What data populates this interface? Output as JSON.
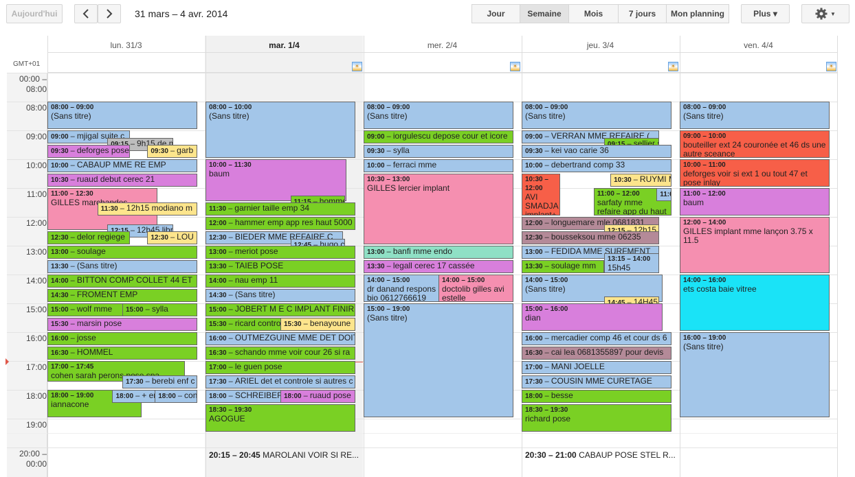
{
  "toolbar": {
    "today_label": "Aujourd'hui",
    "prev_icon": "chevron-left-icon",
    "next_icon": "chevron-right-icon",
    "date_range": "31 mars – 4 avr. 2014",
    "views": [
      "Jour",
      "Semaine",
      "Mois",
      "7 jours",
      "Mon planning"
    ],
    "active_view": "Semaine",
    "more_label": "Plus ▾",
    "settings_icon": "gear-icon"
  },
  "timezone": "GMT+01",
  "days": [
    {
      "label": "lun. 31/3",
      "today": false
    },
    {
      "label": "mar. 1/4",
      "today": true
    },
    {
      "label": "mer. 2/4",
      "today": false
    },
    {
      "label": "jeu. 3/4",
      "today": false
    },
    {
      "label": "ven. 4/4",
      "today": false
    }
  ],
  "hours": [
    "00:00 – 08:00",
    "08:00",
    "09:00",
    "10:00",
    "11:00",
    "12:00",
    "13:00",
    "14:00",
    "15:00",
    "16:00",
    "17:00",
    "18:00",
    "19:00",
    "20:00 – 00:00"
  ],
  "colors": {
    "blue": "#a3c6e9",
    "green": "#7ad024",
    "pink": "#f58fb0",
    "purple": "#d87fdc",
    "red": "#f75f48",
    "yellow": "#fde58c",
    "mauve": "#b48a98",
    "teal": "#8fe0c5",
    "cyan": "#1ae3f7",
    "gray": "#bdbdbd",
    "today_bg": "#f1f1f1"
  },
  "events": [
    {
      "day": 0,
      "start": 8,
      "end": 9,
      "time": "08:00 – 09:00",
      "title": "(Sans titre)",
      "color": "blue",
      "col": 0,
      "cols": 1,
      "tall": true
    },
    {
      "day": 0,
      "start": 9,
      "end": 9.5,
      "time": "09:00",
      "title": "mjigal suite c",
      "color": "blue",
      "col": 0,
      "cols": 2
    },
    {
      "day": 0,
      "start": 9.25,
      "end": 9.75,
      "time": "09:15",
      "title": "9h15 de mota",
      "color": "gray",
      "col": 1,
      "cols": 2.5
    },
    {
      "day": 0,
      "start": 9.5,
      "end": 10,
      "time": "09:30",
      "title": "deforges pose",
      "color": "purple",
      "col": 0,
      "cols": 2
    },
    {
      "day": 0,
      "start": 9.5,
      "end": 10,
      "time": "09:30",
      "title": "garb",
      "color": "yellow",
      "col": 2,
      "cols": 3
    },
    {
      "day": 0,
      "start": 10,
      "end": 10.5,
      "time": "10:00",
      "title": "CABAUP MME RE EMP",
      "color": "blue",
      "col": 0,
      "cols": 1
    },
    {
      "day": 0,
      "start": 10.5,
      "end": 11,
      "time": "10:30",
      "title": "ruaud debut cerec 21",
      "color": "purple",
      "col": 0,
      "cols": 1
    },
    {
      "day": 0,
      "start": 11,
      "end": 12.5,
      "time": "11:00 – 12:30",
      "title": "GILLES marchandes",
      "color": "pink",
      "col": 0,
      "cols": 1.5,
      "tall": true
    },
    {
      "day": 0,
      "start": 11.5,
      "end": 12,
      "time": "11:30",
      "title": "12h15 modiano m",
      "color": "yellow",
      "col": 1,
      "cols": 3,
      "span": 2
    },
    {
      "day": 0,
      "start": 12.25,
      "end": 12.75,
      "time": "12:15",
      "title": "12h45 libratis",
      "color": "blue",
      "col": 1,
      "cols": 2.5
    },
    {
      "day": 0,
      "start": 12.5,
      "end": 13,
      "time": "12:30",
      "title": "delor regiege",
      "color": "green",
      "col": 0,
      "cols": 2
    },
    {
      "day": 0,
      "start": 12.5,
      "end": 13,
      "time": "12:30",
      "title": "LOU",
      "color": "yellow",
      "col": 2,
      "cols": 3
    },
    {
      "day": 0,
      "start": 13,
      "end": 13.5,
      "time": "13:00",
      "title": "soulage",
      "color": "green",
      "col": 0,
      "cols": 1
    },
    {
      "day": 0,
      "start": 13.5,
      "end": 14,
      "time": "13:30",
      "title": "(Sans titre)",
      "color": "blue",
      "col": 0,
      "cols": 1
    },
    {
      "day": 0,
      "start": 14,
      "end": 14.5,
      "time": "14:00",
      "title": "BITTON COMP COLLET 44 ET ",
      "color": "green",
      "col": 0,
      "cols": 1
    },
    {
      "day": 0,
      "start": 14.5,
      "end": 15,
      "time": "14:30",
      "title": "FROMENT EMP",
      "color": "green",
      "col": 0,
      "cols": 1
    },
    {
      "day": 0,
      "start": 15,
      "end": 15.5,
      "time": "15:00",
      "title": "wolf mme",
      "color": "green",
      "col": 0,
      "cols": 2
    },
    {
      "day": 0,
      "start": 15,
      "end": 15.5,
      "time": "15:00",
      "title": "sylla",
      "color": "green",
      "col": 1,
      "cols": 2
    },
    {
      "day": 0,
      "start": 15.5,
      "end": 16,
      "time": "15:30",
      "title": "marsin pose",
      "color": "purple",
      "col": 0,
      "cols": 1
    },
    {
      "day": 0,
      "start": 16,
      "end": 16.5,
      "time": "16:00",
      "title": "josse",
      "color": "green",
      "col": 0,
      "cols": 1
    },
    {
      "day": 0,
      "start": 16.5,
      "end": 17,
      "time": "16:30",
      "title": "HOMMEL",
      "color": "green",
      "col": 0,
      "cols": 1
    },
    {
      "day": 0,
      "start": 17,
      "end": 17.75,
      "time": "17:00 – 17:45",
      "title": "cohen sarah perons pose spa",
      "color": "green",
      "col": 0,
      "cols": 1.2,
      "tall": true
    },
    {
      "day": 0,
      "start": 17.5,
      "end": 18,
      "time": "17:30",
      "title": "berebi enf c",
      "color": "blue",
      "col": 1.1,
      "cols": 2.2
    },
    {
      "day": 0,
      "start": 18,
      "end": 19,
      "time": "18:00 – 19:00",
      "title": "iannacone",
      "color": "green",
      "col": 0,
      "cols": 1.75,
      "tall": true
    },
    {
      "day": 0,
      "start": 18,
      "end": 18.5,
      "time": "18:00",
      "title": "+ enf",
      "color": "blue",
      "col": 1.3,
      "cols": 3
    },
    {
      "day": 0,
      "start": 18,
      "end": 18.5,
      "time": "18:00",
      "title": "contr",
      "color": "blue",
      "col": 2.15,
      "cols": 3
    },
    {
      "day": 1,
      "start": 8,
      "end": 10,
      "time": "08:00 – 10:00",
      "title": "(Sans titre)",
      "color": "blue",
      "col": 0,
      "cols": 1,
      "tall": true
    },
    {
      "day": 1,
      "start": 10,
      "end": 11.5,
      "time": "10:00 – 11:30",
      "title": "baum",
      "color": "purple",
      "col": 0,
      "cols": 1.17,
      "tall": true
    },
    {
      "day": 1,
      "start": 11.25,
      "end": 11.75,
      "time": "11:15",
      "title": "hommel ve",
      "color": "green",
      "col": 1.7,
      "cols": 3
    },
    {
      "day": 1,
      "start": 11.5,
      "end": 12,
      "time": "11:30",
      "title": "garnier taille emp 34",
      "color": "green",
      "col": 0,
      "cols": 1
    },
    {
      "day": 1,
      "start": 12,
      "end": 12.5,
      "time": "12:00",
      "title": "hammer emp app res haut 5000",
      "color": "green",
      "col": 0,
      "cols": 1
    },
    {
      "day": 1,
      "start": 12.5,
      "end": 13,
      "time": "12:30",
      "title": "BIEDER MME REFAIRE C",
      "color": "blue",
      "col": 0,
      "cols": 1.2
    },
    {
      "day": 1,
      "start": 12.75,
      "end": 13.25,
      "time": "12:45",
      "title": "hugo comp",
      "color": "blue",
      "col": 1.7,
      "cols": 3
    },
    {
      "day": 1,
      "start": 13,
      "end": 13.5,
      "time": "13:00",
      "title": "meriot pose",
      "color": "green",
      "col": 0,
      "cols": 1
    },
    {
      "day": 1,
      "start": 13.5,
      "end": 14,
      "time": "13:30",
      "title": "TAIEB POSE",
      "color": "green",
      "col": 0,
      "cols": 1
    },
    {
      "day": 1,
      "start": 14,
      "end": 14.5,
      "time": "14:00",
      "title": "nau emp 11",
      "color": "green",
      "col": 0,
      "cols": 1
    },
    {
      "day": 1,
      "start": 14.5,
      "end": 15,
      "time": "14:30",
      "title": "(Sans titre)",
      "color": "blue",
      "col": 0,
      "cols": 1
    },
    {
      "day": 1,
      "start": 15,
      "end": 15.5,
      "time": "15:00",
      "title": "JOBERT M E C IMPLANT FINIR",
      "color": "green",
      "col": 0,
      "cols": 1
    },
    {
      "day": 1,
      "start": 15.5,
      "end": 16,
      "time": "15:30",
      "title": "ricard contro",
      "color": "green",
      "col": 0,
      "cols": 2
    },
    {
      "day": 1,
      "start": 15.5,
      "end": 16,
      "time": "15:30",
      "title": "benayoune",
      "color": "yellow",
      "col": 1,
      "cols": 2
    },
    {
      "day": 1,
      "start": 16,
      "end": 16.5,
      "time": "16:00",
      "title": "OUTMEZGUINE MME DET DOIT",
      "color": "blue",
      "col": 0,
      "cols": 1
    },
    {
      "day": 1,
      "start": 16.5,
      "end": 17,
      "time": "16:30",
      "title": "schando mme voir cour 26 si ra",
      "color": "green",
      "col": 0,
      "cols": 1
    },
    {
      "day": 1,
      "start": 17,
      "end": 17.5,
      "time": "17:00",
      "title": "le guen pose",
      "color": "green",
      "col": 0,
      "cols": 1
    },
    {
      "day": 1,
      "start": 17.5,
      "end": 18,
      "time": "17:30",
      "title": "ARIEL det et controle si autres c",
      "color": "blue",
      "col": 0,
      "cols": 1
    },
    {
      "day": 1,
      "start": 18,
      "end": 18.5,
      "time": "18:00",
      "title": "SCHREIBER",
      "color": "blue",
      "col": 0,
      "cols": 2
    },
    {
      "day": 1,
      "start": 18,
      "end": 18.5,
      "time": "18:00",
      "title": "ruaud pose",
      "color": "purple",
      "col": 1,
      "cols": 2
    },
    {
      "day": 1,
      "start": 18.5,
      "end": 19.5,
      "time": "18:30 – 19:30",
      "title": "AGOGUE",
      "color": "green",
      "col": 0,
      "cols": 1,
      "tall": true
    },
    {
      "day": 2,
      "start": 8,
      "end": 9,
      "time": "08:00 – 09:00",
      "title": "(Sans titre)",
      "color": "blue",
      "col": 0,
      "cols": 1,
      "tall": true
    },
    {
      "day": 2,
      "start": 9,
      "end": 9.5,
      "time": "09:00",
      "title": "iorgulescu depose cour et icore",
      "color": "green",
      "col": 0,
      "cols": 1
    },
    {
      "day": 2,
      "start": 9.5,
      "end": 10,
      "time": "09:30",
      "title": "sylla",
      "color": "blue",
      "col": 0,
      "cols": 1
    },
    {
      "day": 2,
      "start": 10,
      "end": 10.5,
      "time": "10:00",
      "title": "ferraci mme",
      "color": "blue",
      "col": 0,
      "cols": 1
    },
    {
      "day": 2,
      "start": 10.5,
      "end": 13,
      "time": "10:30 – 13:00",
      "title": "GILLES lercier implant",
      "color": "pink",
      "col": 0,
      "cols": 1,
      "tall": true
    },
    {
      "day": 2,
      "start": 13,
      "end": 13.5,
      "time": "13:00",
      "title": "banfi mme endo",
      "color": "teal",
      "col": 0,
      "cols": 1
    },
    {
      "day": 2,
      "start": 13.5,
      "end": 14,
      "time": "13:30",
      "title": "legall cerec 17 cassée",
      "color": "purple",
      "col": 0,
      "cols": 1
    },
    {
      "day": 2,
      "start": 14,
      "end": 15,
      "time": "14:00 – 15:00",
      "title": "dr danand respons bio 0612766619",
      "color": "blue",
      "col": 0,
      "cols": 2,
      "tall": true
    },
    {
      "day": 2,
      "start": 14,
      "end": 15,
      "time": "14:00 – 15:00",
      "title": "doctolib gilles avi estelle",
      "color": "pink",
      "col": 1,
      "cols": 2,
      "tall": true
    },
    {
      "day": 2,
      "start": 15,
      "end": 19,
      "time": "15:00 – 19:00",
      "title": "(Sans titre)",
      "color": "blue",
      "col": 0,
      "cols": 1,
      "tall": true
    },
    {
      "day": 3,
      "start": 8,
      "end": 9,
      "time": "08:00 – 09:00",
      "title": "(Sans titre)",
      "color": "blue",
      "col": 0,
      "cols": 1,
      "tall": true
    },
    {
      "day": 3,
      "start": 9,
      "end": 9.5,
      "time": "09:00",
      "title": "VERRAN MME REFAIRE (",
      "color": "blue",
      "col": 0,
      "cols": 1.2
    },
    {
      "day": 3,
      "start": 9.25,
      "end": 9.75,
      "time": "09:15",
      "title": "sellier suite",
      "color": "green",
      "col": 1.65,
      "cols": 3
    },
    {
      "day": 3,
      "start": 9.5,
      "end": 10,
      "time": "09:30",
      "title": "kei vao carie 36",
      "color": "blue",
      "col": 0,
      "cols": 1
    },
    {
      "day": 3,
      "start": 10,
      "end": 10.5,
      "time": "10:00",
      "title": "debertrand comp 33",
      "color": "blue",
      "col": 0,
      "cols": 1
    },
    {
      "day": 3,
      "start": 10.5,
      "end": 12,
      "time": "10:30 – 12:00",
      "title": "AVI SMADJA implant+ sur 4.2/10mm",
      "color": "red",
      "col": 0,
      "cols": 4.3,
      "tall": true
    },
    {
      "day": 3,
      "start": 10.5,
      "end": 11,
      "time": "10:30",
      "title": "RUYMI MME RECE",
      "color": "yellow",
      "col": 0.77,
      "cols": 1.3
    },
    {
      "day": 3,
      "start": 11,
      "end": 12,
      "time": "11:00 – 12:00",
      "title": "sarfaty mme refaire app du haut emp",
      "color": "green",
      "col": 0.77,
      "cols": 1.6,
      "tall": true
    },
    {
      "day": 3,
      "start": 11,
      "end": 11.5,
      "time": "11:00",
      "title": "sarfa",
      "color": "blue",
      "col": 2.7,
      "cols": 3
    },
    {
      "day": 3,
      "start": 12,
      "end": 12.5,
      "time": "12:00",
      "title": "longuemare mle 0681831",
      "color": "mauve",
      "col": 0,
      "cols": 1.2
    },
    {
      "day": 3,
      "start": 12.25,
      "end": 12.75,
      "time": "12:15",
      "title": "12h15 ankr",
      "color": "yellow",
      "col": 1.65,
      "cols": 3
    },
    {
      "day": 3,
      "start": 12.5,
      "end": 13,
      "time": "12:30",
      "title": "bousseksou mme 06235",
      "color": "mauve",
      "col": 0,
      "cols": 1.2
    },
    {
      "day": 3,
      "start": 13,
      "end": 13.5,
      "time": "13:00",
      "title": "FEDIDA MME SURFMENT",
      "color": "blue",
      "col": 0,
      "cols": 1.2
    },
    {
      "day": 3,
      "start": 13.25,
      "end": 14,
      "time": "13:15 – 14:00",
      "title": "15h45 geffroy",
      "color": "blue",
      "col": 1.65,
      "cols": 3,
      "tall": true
    },
    {
      "day": 3,
      "start": 13.5,
      "end": 14,
      "time": "13:30",
      "title": "soulage mm",
      "color": "green",
      "col": 0,
      "cols": 2
    },
    {
      "day": 3,
      "start": 14,
      "end": 15,
      "time": "14:00 – 15:00",
      "title": "(Sans titre)",
      "color": "blue",
      "col": 0,
      "cols": 1.17,
      "tall": true
    },
    {
      "day": 3,
      "start": 14.75,
      "end": 15.25,
      "time": "14:45",
      "title": "14H45 MAR",
      "color": "yellow",
      "col": 1.65,
      "cols": 3
    },
    {
      "day": 3,
      "start": 15,
      "end": 16,
      "time": "15:00 – 16:00",
      "title": "dian",
      "color": "purple",
      "col": 0,
      "cols": 1.17,
      "tall": true
    },
    {
      "day": 3,
      "start": 16,
      "end": 16.5,
      "time": "16:00",
      "title": "mercadier comp 46 et cour ds 6",
      "color": "blue",
      "col": 0,
      "cols": 1
    },
    {
      "day": 3,
      "start": 16.5,
      "end": 17,
      "time": "16:30",
      "title": "cai lea 0681355897 pour devis",
      "color": "mauve",
      "col": 0,
      "cols": 1
    },
    {
      "day": 3,
      "start": 17,
      "end": 17.5,
      "time": "17:00",
      "title": "MANI JOELLE",
      "color": "blue",
      "col": 0,
      "cols": 1
    },
    {
      "day": 3,
      "start": 17.5,
      "end": 18,
      "time": "17:30",
      "title": "COUSIN MME CURETAGE",
      "color": "blue",
      "col": 0,
      "cols": 1
    },
    {
      "day": 3,
      "start": 18,
      "end": 18.5,
      "time": "18:00",
      "title": "besse",
      "color": "green",
      "col": 0,
      "cols": 1
    },
    {
      "day": 3,
      "start": 18.5,
      "end": 19.5,
      "time": "18:30 – 19:30",
      "title": "richard pose",
      "color": "green",
      "col": 0,
      "cols": 1,
      "tall": true
    },
    {
      "day": 4,
      "start": 8,
      "end": 9,
      "time": "08:00 – 09:00",
      "title": "(Sans titre)",
      "color": "blue",
      "col": 0,
      "cols": 1,
      "tall": true
    },
    {
      "day": 4,
      "start": 9,
      "end": 10,
      "time": "09:00 – 10:00",
      "title": "bouteiller ext 24 couronée et 46 ds une autre sceance",
      "color": "red",
      "col": 0,
      "cols": 1,
      "tall": true
    },
    {
      "day": 4,
      "start": 10,
      "end": 11,
      "time": "10:00 – 11:00",
      "title": "deforges voir si ext 1 ou tout 47 et pose inlay",
      "color": "red",
      "col": 0,
      "cols": 1,
      "tall": true
    },
    {
      "day": 4,
      "start": 11,
      "end": 12,
      "time": "11:00 – 12:00",
      "title": "baum",
      "color": "purple",
      "col": 0,
      "cols": 1,
      "tall": true
    },
    {
      "day": 4,
      "start": 12,
      "end": 14,
      "time": "12:00 – 14:00",
      "title": "GILLES implant mme lançon 3.75 x 11.5",
      "color": "pink",
      "col": 0,
      "cols": 1,
      "tall": true
    },
    {
      "day": 4,
      "start": 14,
      "end": 16,
      "time": "14:00 – 16:00",
      "title": "ets costa baie vitree",
      "color": "cyan",
      "col": 0,
      "cols": 1,
      "tall": true
    },
    {
      "day": 4,
      "start": 16,
      "end": 19,
      "time": "16:00 – 19:00",
      "title": "(Sans titre)",
      "color": "blue",
      "col": 0,
      "cols": 1,
      "tall": true
    }
  ],
  "late_events": [
    {
      "day": 1,
      "time": "20:15 – 20:45",
      "title": "MAROLANI VOIR SI RE..."
    },
    {
      "day": 3,
      "time": "20:30 – 21:00",
      "title": "CABAUP POSE STEL R..."
    }
  ]
}
